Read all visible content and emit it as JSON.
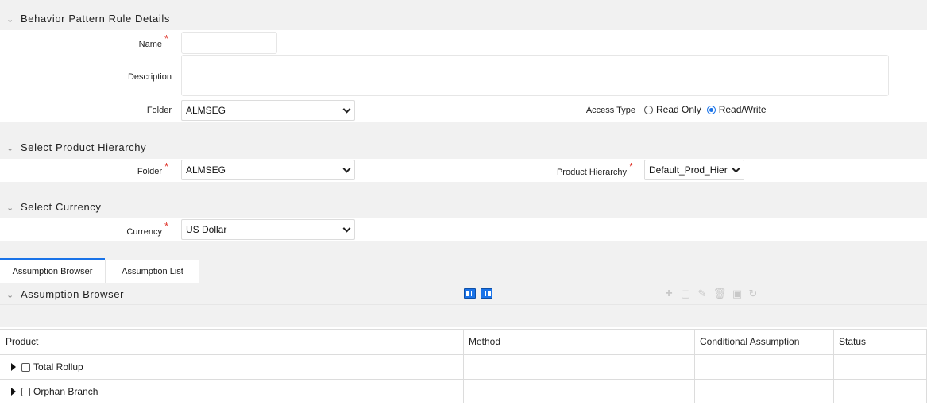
{
  "details": {
    "title": "Behavior Pattern Rule Details",
    "name_label": "Name",
    "name_value": "",
    "description_label": "Description",
    "description_value": "",
    "folder_label": "Folder",
    "folder_value": "ALMSEG",
    "access_type_label": "Access Type",
    "access_read_only": "Read Only",
    "access_read_write": "Read/Write",
    "access_selected": "Read/Write"
  },
  "hierarchy": {
    "title": "Select Product Hierarchy",
    "folder_label": "Folder",
    "folder_value": "ALMSEG",
    "product_hierarchy_label": "Product Hierarchy",
    "product_hierarchy_value": "Default_Prod_Hier"
  },
  "currency": {
    "title": "Select Currency",
    "currency_label": "Currency",
    "currency_value": "US Dollar"
  },
  "tabs": [
    {
      "label": "Assumption Browser",
      "active": true
    },
    {
      "label": "Assumption List",
      "active": false
    }
  ],
  "browser": {
    "title": "Assumption Browser",
    "columns": [
      "Product",
      "Method",
      "Conditional Assumption",
      "Status"
    ],
    "rows": [
      {
        "product": "Total Rollup",
        "method": "",
        "conditional": "",
        "status": ""
      },
      {
        "product": "Orphan Branch",
        "method": "",
        "conditional": "",
        "status": ""
      }
    ]
  },
  "colors": {
    "accent": "#1a73e8",
    "required": "#e0342a",
    "band": "#f1f1f1"
  }
}
